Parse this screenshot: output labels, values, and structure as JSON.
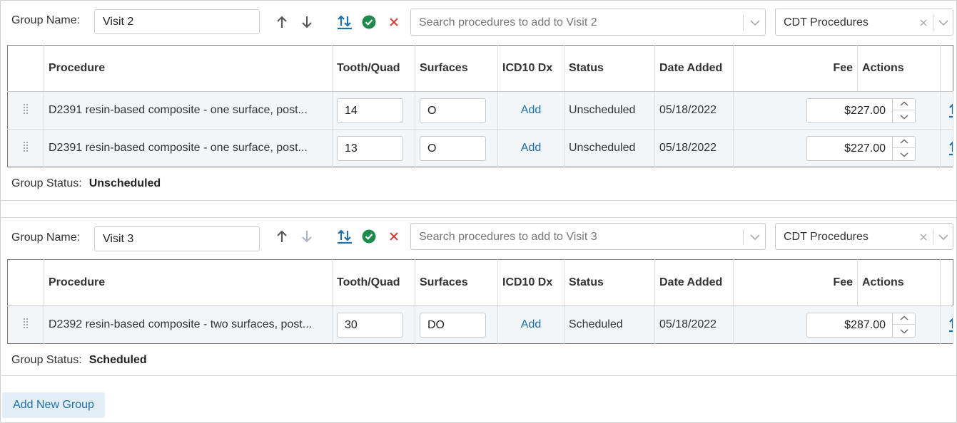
{
  "labels": {
    "group_name": "Group Name:",
    "group_status": "Group Status:",
    "add_new_group": "Add New Group"
  },
  "columns": [
    "Procedure",
    "Tooth/Quad",
    "Surfaces",
    "ICD10 Dx",
    "Status",
    "Date Added",
    "Fee",
    "Actions"
  ],
  "colors": {
    "accent": "#1f6fa8",
    "check": "#1e8a4c",
    "remove": "#d23a3a",
    "row_bg": "#f3f6f9"
  },
  "icons": [
    "arrow-up-icon",
    "arrow-down-icon",
    "swap-icon",
    "check-circle-icon",
    "close-icon",
    "chevron-down-icon",
    "drag-handle-icon"
  ],
  "groups": [
    {
      "name": "Visit 2",
      "search_placeholder": "Search procedures to add to Visit 2",
      "code_set": "CDT Procedures",
      "status": "Unscheduled",
      "rows": [
        {
          "procedure": "D2391 resin-based composite - one surface, post...",
          "tooth": "14",
          "surfaces": "O",
          "icd": "Add",
          "status": "Unscheduled",
          "date": "05/18/2022",
          "fee": "$227.00"
        },
        {
          "procedure": "D2391 resin-based composite - one surface, post...",
          "tooth": "13",
          "surfaces": "O",
          "icd": "Add",
          "status": "Unscheduled",
          "date": "05/18/2022",
          "fee": "$227.00"
        }
      ]
    },
    {
      "name": "Visit 3",
      "search_placeholder": "Search procedures to add to Visit 3",
      "code_set": "CDT Procedures",
      "status": "Scheduled",
      "rows": [
        {
          "procedure": "D2392 resin-based composite - two surfaces, post...",
          "tooth": "30",
          "surfaces": "DO",
          "icd": "Add",
          "status": "Scheduled",
          "date": "05/18/2022",
          "fee": "$287.00"
        }
      ]
    }
  ]
}
